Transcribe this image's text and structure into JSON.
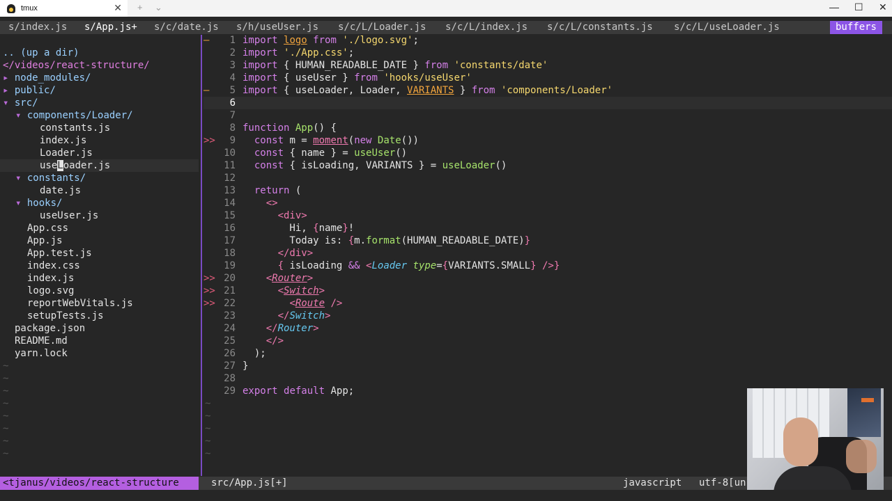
{
  "window": {
    "title": "tmux",
    "close_glyph": "✕",
    "new_tab_glyph": "+",
    "dropdown_glyph": "⌄",
    "minimize_glyph": "—",
    "maximize_glyph": "☐",
    "close_window_glyph": "✕"
  },
  "buffers": {
    "tabs": [
      "s/index.js",
      "s/App.js+",
      "s/c/date.js",
      "s/h/useUser.js",
      "s/c/L/Loader.js",
      "s/c/L/index.js",
      "s/c/L/constants.js",
      "s/c/L/useLoader.js"
    ],
    "label": "buffers"
  },
  "tree": {
    "up": ".. (up a dir)",
    "root": "</videos/react-structure/",
    "items": [
      "node_modules/",
      "public/",
      "src/",
      "components/Loader/",
      "constants.js",
      "index.js",
      "Loader.js",
      "useLoader.js",
      "constants/",
      "date.js",
      "hooks/",
      "useUser.js",
      "App.css",
      "App.js",
      "App.test.js",
      "index.css",
      "index.js",
      "logo.svg",
      "reportWebVitals.js",
      "setupTests.js",
      "package.json",
      "README.md",
      "yarn.lock"
    ],
    "arrows": {
      "closed": "▸",
      "open": "▾"
    },
    "tilde": "~"
  },
  "editor": {
    "signs": {
      "removed": "—",
      "error": ">>"
    },
    "lines": [
      "import logo from './logo.svg';",
      "import './App.css';",
      "import { HUMAN_READABLE_DATE } from 'constants/date'",
      "import { useUser } from 'hooks/useUser'",
      "import { useLoader, Loader, VARIANTS } from 'components/Loader'",
      "",
      "",
      "function App() {",
      "  const m = moment(new Date())",
      "  const { name } = useUser()",
      "  const { isLoading, VARIANTS } = useLoader()",
      "",
      "  return (",
      "    <>",
      "      <div>",
      "        Hi, {name}!",
      "        Today is: {m.format(HUMAN_READABLE_DATE)}",
      "      </div>",
      "      { isLoading && <Loader type={VARIANTS.SMALL} />}",
      "    <Router>",
      "      <Switch>",
      "        <Route />",
      "      </Switch>",
      "    </Router>",
      "    </>",
      "  );",
      "}",
      "",
      "export default App;"
    ],
    "tilde": "~"
  },
  "status": {
    "path": "<tjanus/videos/react-structure",
    "file": "src/App.js[+]",
    "filetype": "javascript",
    "encoding": "utf-8[un"
  },
  "colors": {
    "accent_purple": "#8c55e6",
    "status_path": "#b45fe0",
    "sign_error": "#e05a7a",
    "string": "#f5d76e",
    "keyword": "#d480e8",
    "function": "#a6e26b"
  }
}
